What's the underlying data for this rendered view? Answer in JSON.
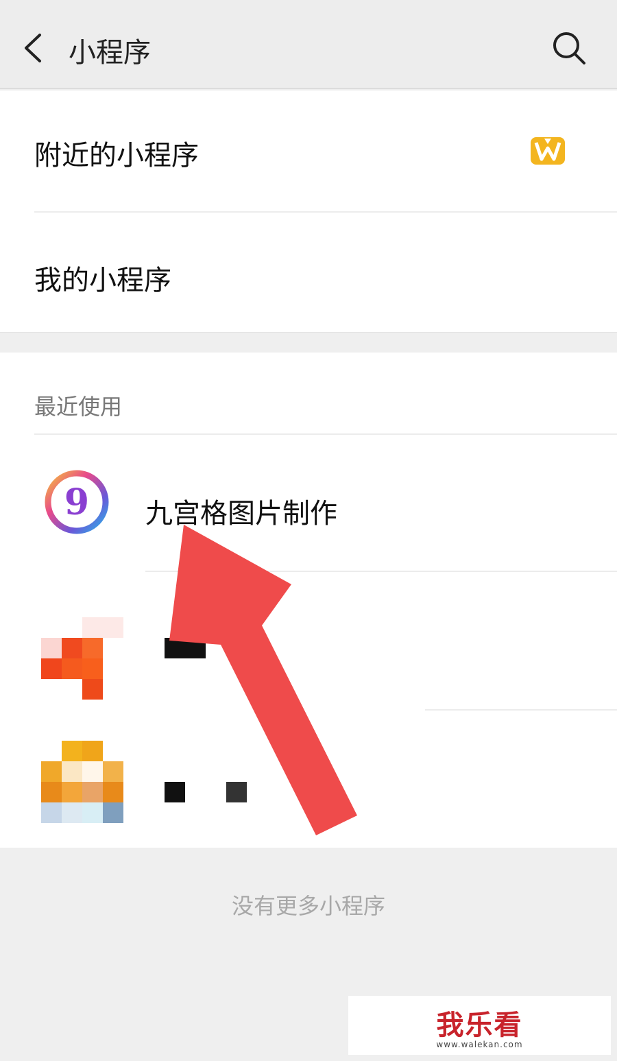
{
  "header": {
    "title": "小程序",
    "back_icon": "chevron-left-icon",
    "search_icon": "search-icon"
  },
  "menu": {
    "nearby_label": "附近的小程序",
    "nearby_icon": "crown-w-icon",
    "mine_label": "我的小程序"
  },
  "recent": {
    "section_label": "最近使用",
    "items": [
      {
        "name": "九宫格图片制作",
        "icon": "nine-grid-app-icon"
      },
      {
        "name": "",
        "icon": "pixelated-app-icon-orange"
      },
      {
        "name": "",
        "icon": "pixelated-app-icon-yellow"
      }
    ]
  },
  "footer": {
    "text": "没有更多小程序"
  },
  "watermark": {
    "title": "我乐看",
    "url": "www.walekan.com"
  },
  "colors": {
    "arrow": "#ef4b4b",
    "crown": "#f3b51f",
    "accent_red": "#c8232b"
  }
}
